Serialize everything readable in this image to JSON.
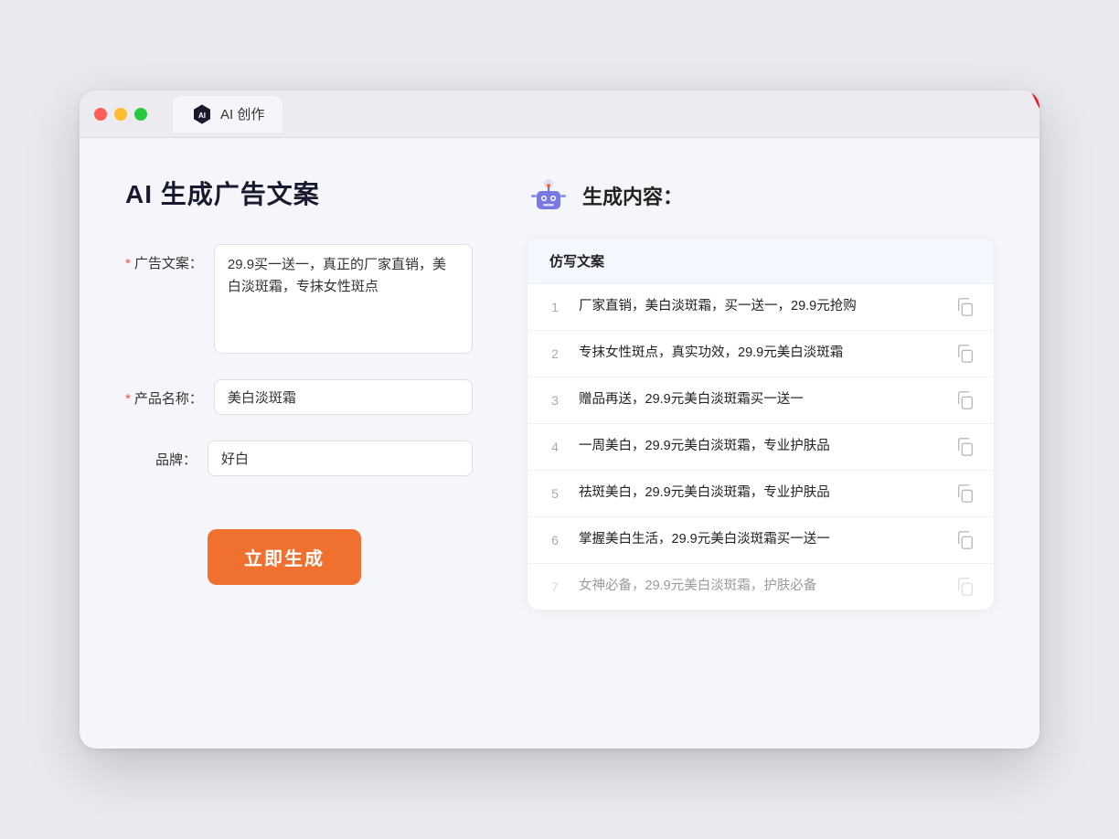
{
  "browser": {
    "tab_label": "AI 创作"
  },
  "left_panel": {
    "title": "AI 生成广告文案",
    "form": {
      "ad_copy_label": "广告文案：",
      "ad_copy_required": true,
      "ad_copy_value": "29.9买一送一，真正的厂家直销，美白淡斑霜，专抹女性斑点",
      "product_name_label": "产品名称：",
      "product_name_required": true,
      "product_name_value": "美白淡斑霜",
      "brand_label": "品牌：",
      "brand_required": false,
      "brand_value": "好白",
      "generate_btn_label": "立即生成"
    }
  },
  "right_panel": {
    "title": "生成内容：",
    "table_header": "仿写文案",
    "results": [
      {
        "num": 1,
        "text": "厂家直销，美白淡斑霜，买一送一，29.9元抢购",
        "faded": false
      },
      {
        "num": 2,
        "text": "专抹女性斑点，真实功效，29.9元美白淡斑霜",
        "faded": false
      },
      {
        "num": 3,
        "text": "赠品再送，29.9元美白淡斑霜买一送一",
        "faded": false
      },
      {
        "num": 4,
        "text": "一周美白，29.9元美白淡斑霜，专业护肤品",
        "faded": false
      },
      {
        "num": 5,
        "text": "祛斑美白，29.9元美白淡斑霜，专业护肤品",
        "faded": false
      },
      {
        "num": 6,
        "text": "掌握美白生活，29.9元美白淡斑霜买一送一",
        "faded": false
      },
      {
        "num": 7,
        "text": "女神必备，29.9元美白淡斑霜，护肤必备",
        "faded": true
      }
    ]
  }
}
